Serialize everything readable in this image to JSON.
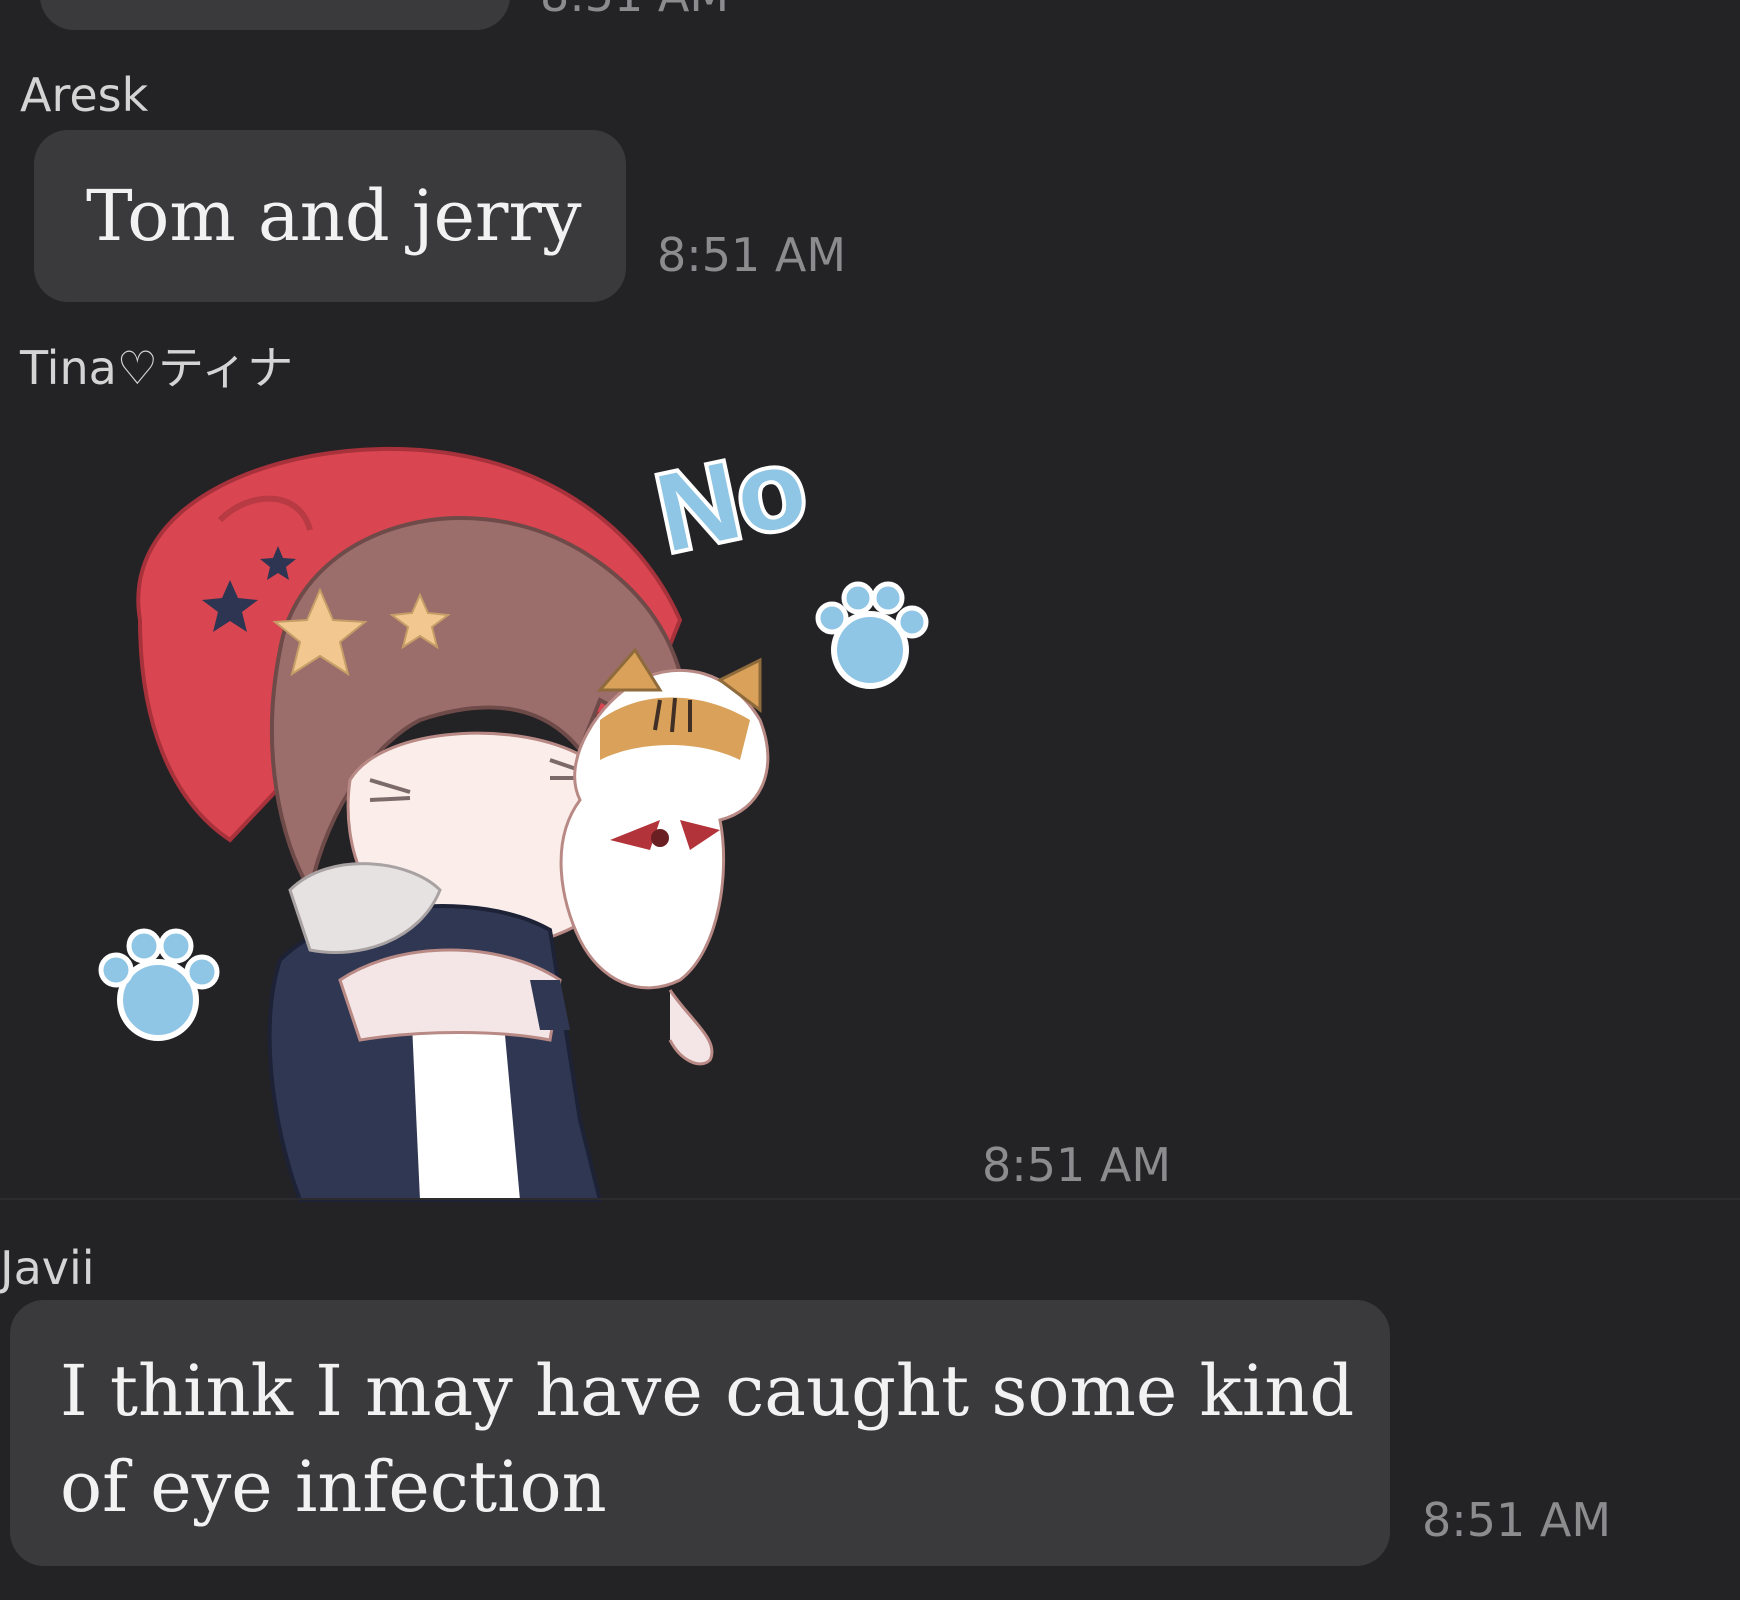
{
  "messages": [
    {
      "time": "8:51 AM"
    },
    {
      "sender": "Aresk",
      "text": "Tom and jerry",
      "time": "8:51 AM"
    },
    {
      "sender": "Tina♡ティナ",
      "sticker": {
        "caption": "No",
        "icon": "cat-hug-sticker"
      },
      "time": "8:51 AM"
    },
    {
      "sender": "Javii",
      "text_lines": [
        "I think I may have caught some kind",
        "of eye infection"
      ],
      "time": "8:51 AM"
    }
  ],
  "colors": {
    "background": "#232225",
    "bubble": "#3a393c",
    "text": "#f2f2f2",
    "timestamp": "#8c8c8f",
    "sender": "#d4d4d4"
  }
}
